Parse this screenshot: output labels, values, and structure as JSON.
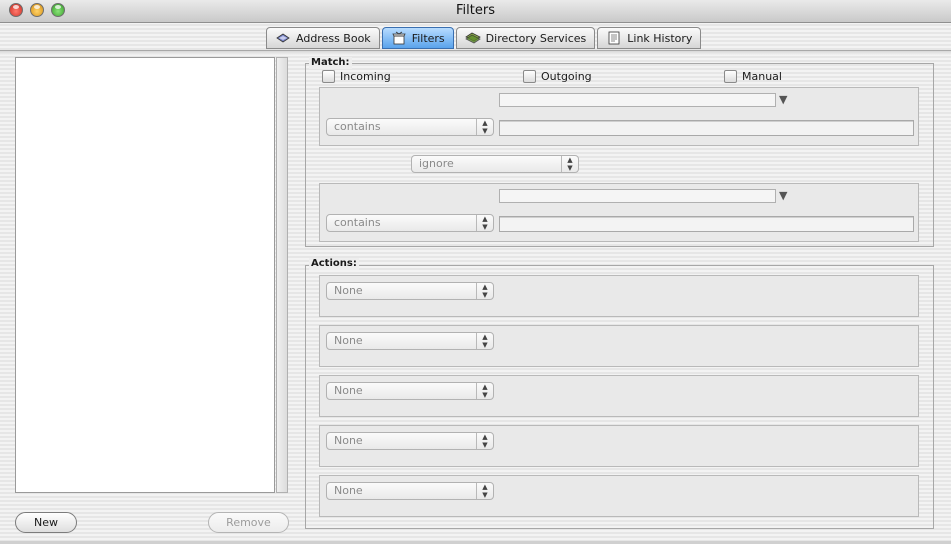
{
  "window": {
    "title": "Filters"
  },
  "tabs": [
    {
      "label": "Address Book",
      "icon": "address-book-icon"
    },
    {
      "label": "Filters",
      "icon": "filters-icon",
      "active": true
    },
    {
      "label": "Directory Services",
      "icon": "directory-services-icon"
    },
    {
      "label": "Link History",
      "icon": "link-history-icon"
    }
  ],
  "left_panel": {
    "new_label": "New",
    "remove_label": "Remove"
  },
  "match": {
    "label": "Match:",
    "checkboxes": [
      {
        "label": "Incoming",
        "checked": false
      },
      {
        "label": "Outgoing",
        "checked": false
      },
      {
        "label": "Manual",
        "checked": false
      }
    ],
    "condition1": {
      "field": "",
      "operator": "contains",
      "value": ""
    },
    "joiner": "ignore",
    "condition2": {
      "field": "",
      "operator": "contains",
      "value": ""
    }
  },
  "actions": {
    "label": "Actions:",
    "items": [
      "None",
      "None",
      "None",
      "None",
      "None"
    ]
  },
  "colors": {
    "active_tab": "#5aa3ec",
    "close_light": "#e8473f",
    "minimize_light": "#f2b233",
    "zoom_light": "#4cc23f"
  }
}
